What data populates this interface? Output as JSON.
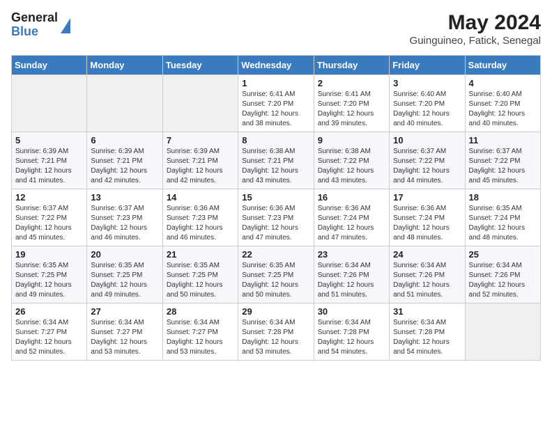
{
  "header": {
    "logo_general": "General",
    "logo_blue": "Blue",
    "month_year": "May 2024",
    "location": "Guinguineo, Fatick, Senegal"
  },
  "days_of_week": [
    "Sunday",
    "Monday",
    "Tuesday",
    "Wednesday",
    "Thursday",
    "Friday",
    "Saturday"
  ],
  "weeks": [
    [
      {
        "day": "",
        "sunrise": "",
        "sunset": "",
        "daylight": "",
        "empty": true
      },
      {
        "day": "",
        "sunrise": "",
        "sunset": "",
        "daylight": "",
        "empty": true
      },
      {
        "day": "",
        "sunrise": "",
        "sunset": "",
        "daylight": "",
        "empty": true
      },
      {
        "day": "1",
        "sunrise": "Sunrise: 6:41 AM",
        "sunset": "Sunset: 7:20 PM",
        "daylight": "Daylight: 12 hours and 38 minutes."
      },
      {
        "day": "2",
        "sunrise": "Sunrise: 6:41 AM",
        "sunset": "Sunset: 7:20 PM",
        "daylight": "Daylight: 12 hours and 39 minutes."
      },
      {
        "day": "3",
        "sunrise": "Sunrise: 6:40 AM",
        "sunset": "Sunset: 7:20 PM",
        "daylight": "Daylight: 12 hours and 40 minutes."
      },
      {
        "day": "4",
        "sunrise": "Sunrise: 6:40 AM",
        "sunset": "Sunset: 7:20 PM",
        "daylight": "Daylight: 12 hours and 40 minutes."
      }
    ],
    [
      {
        "day": "5",
        "sunrise": "Sunrise: 6:39 AM",
        "sunset": "Sunset: 7:21 PM",
        "daylight": "Daylight: 12 hours and 41 minutes."
      },
      {
        "day": "6",
        "sunrise": "Sunrise: 6:39 AM",
        "sunset": "Sunset: 7:21 PM",
        "daylight": "Daylight: 12 hours and 42 minutes."
      },
      {
        "day": "7",
        "sunrise": "Sunrise: 6:39 AM",
        "sunset": "Sunset: 7:21 PM",
        "daylight": "Daylight: 12 hours and 42 minutes."
      },
      {
        "day": "8",
        "sunrise": "Sunrise: 6:38 AM",
        "sunset": "Sunset: 7:21 PM",
        "daylight": "Daylight: 12 hours and 43 minutes."
      },
      {
        "day": "9",
        "sunrise": "Sunrise: 6:38 AM",
        "sunset": "Sunset: 7:22 PM",
        "daylight": "Daylight: 12 hours and 43 minutes."
      },
      {
        "day": "10",
        "sunrise": "Sunrise: 6:37 AM",
        "sunset": "Sunset: 7:22 PM",
        "daylight": "Daylight: 12 hours and 44 minutes."
      },
      {
        "day": "11",
        "sunrise": "Sunrise: 6:37 AM",
        "sunset": "Sunset: 7:22 PM",
        "daylight": "Daylight: 12 hours and 45 minutes."
      }
    ],
    [
      {
        "day": "12",
        "sunrise": "Sunrise: 6:37 AM",
        "sunset": "Sunset: 7:22 PM",
        "daylight": "Daylight: 12 hours and 45 minutes."
      },
      {
        "day": "13",
        "sunrise": "Sunrise: 6:37 AM",
        "sunset": "Sunset: 7:23 PM",
        "daylight": "Daylight: 12 hours and 46 minutes."
      },
      {
        "day": "14",
        "sunrise": "Sunrise: 6:36 AM",
        "sunset": "Sunset: 7:23 PM",
        "daylight": "Daylight: 12 hours and 46 minutes."
      },
      {
        "day": "15",
        "sunrise": "Sunrise: 6:36 AM",
        "sunset": "Sunset: 7:23 PM",
        "daylight": "Daylight: 12 hours and 47 minutes."
      },
      {
        "day": "16",
        "sunrise": "Sunrise: 6:36 AM",
        "sunset": "Sunset: 7:24 PM",
        "daylight": "Daylight: 12 hours and 47 minutes."
      },
      {
        "day": "17",
        "sunrise": "Sunrise: 6:36 AM",
        "sunset": "Sunset: 7:24 PM",
        "daylight": "Daylight: 12 hours and 48 minutes."
      },
      {
        "day": "18",
        "sunrise": "Sunrise: 6:35 AM",
        "sunset": "Sunset: 7:24 PM",
        "daylight": "Daylight: 12 hours and 48 minutes."
      }
    ],
    [
      {
        "day": "19",
        "sunrise": "Sunrise: 6:35 AM",
        "sunset": "Sunset: 7:25 PM",
        "daylight": "Daylight: 12 hours and 49 minutes."
      },
      {
        "day": "20",
        "sunrise": "Sunrise: 6:35 AM",
        "sunset": "Sunset: 7:25 PM",
        "daylight": "Daylight: 12 hours and 49 minutes."
      },
      {
        "day": "21",
        "sunrise": "Sunrise: 6:35 AM",
        "sunset": "Sunset: 7:25 PM",
        "daylight": "Daylight: 12 hours and 50 minutes."
      },
      {
        "day": "22",
        "sunrise": "Sunrise: 6:35 AM",
        "sunset": "Sunset: 7:25 PM",
        "daylight": "Daylight: 12 hours and 50 minutes."
      },
      {
        "day": "23",
        "sunrise": "Sunrise: 6:34 AM",
        "sunset": "Sunset: 7:26 PM",
        "daylight": "Daylight: 12 hours and 51 minutes."
      },
      {
        "day": "24",
        "sunrise": "Sunrise: 6:34 AM",
        "sunset": "Sunset: 7:26 PM",
        "daylight": "Daylight: 12 hours and 51 minutes."
      },
      {
        "day": "25",
        "sunrise": "Sunrise: 6:34 AM",
        "sunset": "Sunset: 7:26 PM",
        "daylight": "Daylight: 12 hours and 52 minutes."
      }
    ],
    [
      {
        "day": "26",
        "sunrise": "Sunrise: 6:34 AM",
        "sunset": "Sunset: 7:27 PM",
        "daylight": "Daylight: 12 hours and 52 minutes."
      },
      {
        "day": "27",
        "sunrise": "Sunrise: 6:34 AM",
        "sunset": "Sunset: 7:27 PM",
        "daylight": "Daylight: 12 hours and 53 minutes."
      },
      {
        "day": "28",
        "sunrise": "Sunrise: 6:34 AM",
        "sunset": "Sunset: 7:27 PM",
        "daylight": "Daylight: 12 hours and 53 minutes."
      },
      {
        "day": "29",
        "sunrise": "Sunrise: 6:34 AM",
        "sunset": "Sunset: 7:28 PM",
        "daylight": "Daylight: 12 hours and 53 minutes."
      },
      {
        "day": "30",
        "sunrise": "Sunrise: 6:34 AM",
        "sunset": "Sunset: 7:28 PM",
        "daylight": "Daylight: 12 hours and 54 minutes."
      },
      {
        "day": "31",
        "sunrise": "Sunrise: 6:34 AM",
        "sunset": "Sunset: 7:28 PM",
        "daylight": "Daylight: 12 hours and 54 minutes."
      },
      {
        "day": "",
        "sunrise": "",
        "sunset": "",
        "daylight": "",
        "empty": true
      }
    ]
  ]
}
